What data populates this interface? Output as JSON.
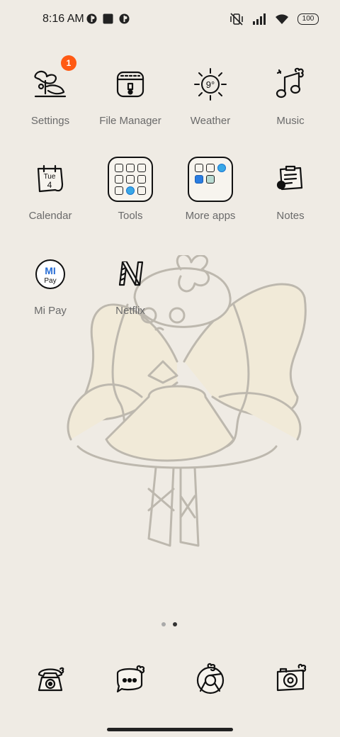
{
  "status_bar": {
    "time": "8:16 AM",
    "battery": "100"
  },
  "apps": [
    {
      "label": "Settings",
      "badge": "1",
      "icon": "settings-doodle-icon"
    },
    {
      "label": "File Manager",
      "icon": "file-manager-doodle-icon"
    },
    {
      "label": "Weather",
      "icon": "weather-sun-icon",
      "temp": "9°"
    },
    {
      "label": "Music",
      "icon": "music-note-icon"
    },
    {
      "label": "Calendar",
      "icon": "calendar-icon",
      "day": "Tue",
      "date": "4"
    },
    {
      "label": "Tools",
      "icon": "folder-icon"
    },
    {
      "label": "More apps",
      "icon": "folder-icon"
    },
    {
      "label": "Notes",
      "icon": "notes-icon"
    },
    {
      "label": "Mi Pay",
      "icon": "mi-pay-icon",
      "mi": "MI",
      "pay": "Pay"
    },
    {
      "label": "Netflix",
      "icon": "netflix-doodle-icon"
    }
  ],
  "dock": [
    {
      "icon": "phone-icon"
    },
    {
      "icon": "messages-icon"
    },
    {
      "icon": "browser-icon"
    },
    {
      "icon": "camera-icon"
    }
  ],
  "page_indicator": {
    "pages": 2,
    "active": 2
  },
  "colors": {
    "background": "#efebe4",
    "badge": "#ff5a14",
    "label": "#6a6a6a"
  }
}
